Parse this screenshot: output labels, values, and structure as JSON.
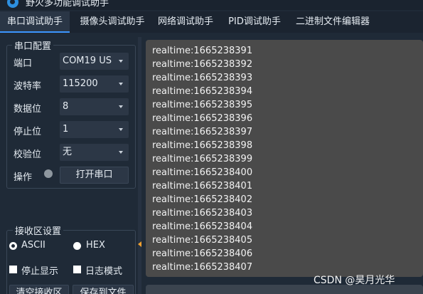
{
  "window": {
    "title": "野火多功能调试助手"
  },
  "tabs": [
    {
      "label": "串口调试助手",
      "active": true
    },
    {
      "label": "摄像头调试助手",
      "active": false
    },
    {
      "label": "网络调试助手",
      "active": false
    },
    {
      "label": "PID调试助手",
      "active": false
    },
    {
      "label": "二进制文件编辑器",
      "active": false
    }
  ],
  "serial_config": {
    "legend": "串口配置",
    "port": {
      "label": "端口",
      "value": "COM19 US"
    },
    "baud": {
      "label": "波特率",
      "value": "115200"
    },
    "databits": {
      "label": "数据位",
      "value": "8"
    },
    "stopbits": {
      "label": "停止位",
      "value": "1"
    },
    "parity": {
      "label": "校验位",
      "value": "无"
    },
    "operate": {
      "label": "操作",
      "button": "打开串口",
      "status_color": "#8e979f"
    }
  },
  "receive_settings": {
    "legend": "接收区设置",
    "ascii": {
      "label": "ASCII",
      "selected": true
    },
    "hex": {
      "label": "HEX",
      "selected": false
    },
    "stop_display": {
      "label": "停止显示",
      "checked": false
    },
    "log_mode": {
      "label": "日志模式",
      "checked": false
    },
    "clear_button": "清空接收区",
    "save_button": "保存到文件"
  },
  "receive_area": {
    "lines": [
      "realtime:1665238391",
      "realtime:1665238392",
      "realtime:1665238393",
      "realtime:1665238394",
      "realtime:1665238395",
      "realtime:1665238396",
      "realtime:1665238397",
      "realtime:1665238398",
      "realtime:1665238399",
      "realtime:1665238400",
      "realtime:1665238401",
      "realtime:1665238402",
      "realtime:1665238403",
      "realtime:1665238404",
      "realtime:1665238405",
      "realtime:1665238406",
      "realtime:1665238407"
    ]
  },
  "watermark": "CSDN @昊月光华",
  "colors": {
    "accent": "#3c96ff",
    "background": "#1f2a37",
    "terminal": "#4a4a4a"
  }
}
